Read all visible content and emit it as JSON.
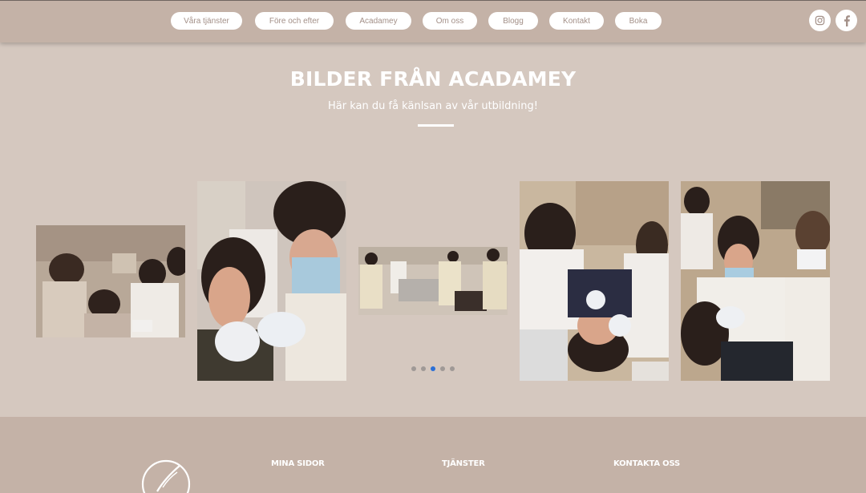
{
  "header": {
    "nav": [
      {
        "label": "Våra tjänster"
      },
      {
        "label": "Före och efter"
      },
      {
        "label": "Acadamey"
      },
      {
        "label": "Om oss"
      },
      {
        "label": "Blogg"
      },
      {
        "label": "Kontakt"
      },
      {
        "label": "Boka"
      }
    ],
    "social": [
      {
        "icon": "instagram-icon"
      },
      {
        "icon": "facebook-icon"
      }
    ]
  },
  "hero": {
    "title": "BILDER FRÅN ACADAMEY",
    "subtitle": "Här kan du få känlsan av vår utbildning!"
  },
  "gallery": {
    "slide_count": 5,
    "active_index": 2,
    "photos": [
      "clinic-training-photo",
      "injection-closeup-photo",
      "classroom-photo",
      "treatment-topdown-photo",
      "practitioner-photo"
    ]
  },
  "footer": {
    "columns": [
      {
        "heading": "MINA SIDOR"
      },
      {
        "heading": "TJÄNSTER"
      },
      {
        "heading": "KONTAKTA OSS"
      }
    ]
  },
  "colors": {
    "page_bg": "#d5c8bf",
    "header_bg": "#c4b2a7",
    "nav_text": "#a39088",
    "active_dot": "#2a6fd6",
    "inactive_dot": "#9f9996"
  }
}
